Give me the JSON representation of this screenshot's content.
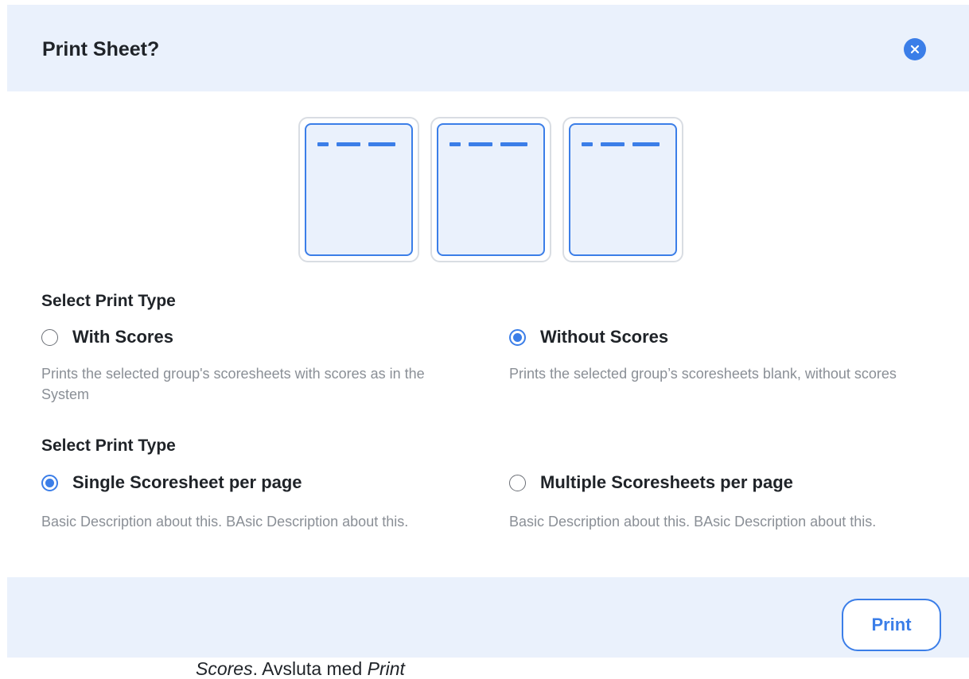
{
  "dialog": {
    "title": "Print Sheet?",
    "close_icon": "close-icon"
  },
  "colors": {
    "accent": "#3b7ee8",
    "panel_bg": "#eaf1fc",
    "description_text": "#8a8f96"
  },
  "print_type_section": {
    "label": "Select Print Type",
    "options": [
      {
        "label": "With Scores",
        "selected": false,
        "description": "Prints the selected group's scoresheets with scores as in the System"
      },
      {
        "label": "Without Scores",
        "selected": true,
        "description": "Prints the selected group’s scoresheets blank, without scores"
      }
    ]
  },
  "layout_section": {
    "label": "Select Print Type",
    "options": [
      {
        "label": "Single Scoresheet per page",
        "selected": true,
        "description": "Basic Description about this. BAsic Description about this."
      },
      {
        "label": "Multiple Scoresheets per page",
        "selected": false,
        "description": "Basic Description about this. BAsic Description about this."
      }
    ]
  },
  "footer": {
    "print_label": "Print"
  },
  "caption": {
    "part1": "Scores",
    "part2": ". Avsluta med ",
    "part3": "Print"
  }
}
